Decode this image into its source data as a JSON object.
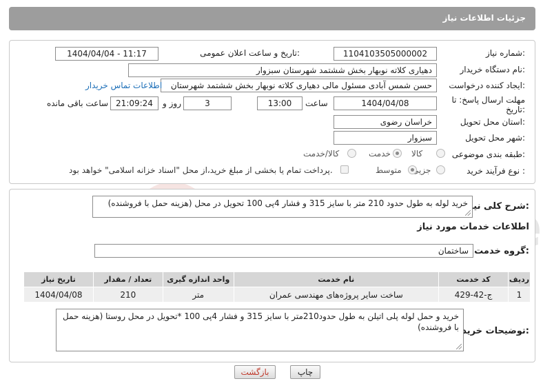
{
  "header": {
    "title": "جزئیات اطلاعات نیاز"
  },
  "form": {
    "need_number": {
      "label": "شماره نیاز:",
      "value": "1104103505000002"
    },
    "announce_datetime": {
      "label": "تاریخ و ساعت اعلان عمومی:",
      "value": "1404/04/04 - 11:17"
    },
    "buyer_org": {
      "label": "نام دستگاه خریدار:",
      "value": "دهیاری کلاته نوبهار بخش ششتمد شهرستان سبزوار"
    },
    "requester": {
      "label": "ایجاد کننده درخواست:",
      "value": "حسن شمس آبادی مسئول مالی دهیاری کلاته نوبهار بخش ششتمد شهرستان",
      "contact_link": "اطلاعات تماس خریدار"
    },
    "deadline": {
      "label_line1": "مهلت ارسال پاسخ: تا",
      "label_line2": "تاریخ:",
      "date": "1404/04/08",
      "time_label": "ساعت",
      "time": "13:00",
      "days": "3",
      "days_label": "روز و",
      "remaining": "21:09:24",
      "remaining_label": "ساعت باقی مانده"
    },
    "province": {
      "label": "استان محل تحویل:",
      "value": "خراسان رضوی"
    },
    "city": {
      "label": "شهر محل تحویل:",
      "value": "سبزوار"
    },
    "category": {
      "label": "طبقه بندی موضوعی:",
      "options": [
        "کالا",
        "خدمت",
        "کالا/خدمت"
      ],
      "selected": "خدمت"
    },
    "process": {
      "label": "نوع فرآیند خرید :",
      "options": [
        "جزیی",
        "متوسط"
      ],
      "selected": "متوسط",
      "payment_note": "پرداخت تمام یا بخشی از مبلغ خرید،از محل \"اسناد خزانه اسلامی\" خواهد بود."
    }
  },
  "summary": {
    "label": "شرح کلی نیاز:",
    "value": "خرید لوله به طول حدود 210 متر با سایز 315 و فشار 4پی 100 تحویل در محل (هزینه حمل با فروشنده)"
  },
  "services": {
    "section_title": "اطلاعات خدمات مورد نیاز",
    "group_label": "گروه خدمت:",
    "group_value": "ساختمان",
    "columns": [
      "ردیف",
      "کد خدمت",
      "نام خدمت",
      "واحد اندازه گیری",
      "تعداد / مقدار",
      "تاریخ نیاز"
    ],
    "rows": [
      {
        "row": "1",
        "code": "ج-42-429",
        "name": "ساخت سایر پروژه‌های مهندسی عمران",
        "unit": "متر",
        "qty": "210",
        "date": "1404/04/08"
      }
    ]
  },
  "buyer_notes": {
    "label": "توضیحات خریدار:",
    "value": "خرید و حمل لوله پلی اتیلن به طول حدود210متر با سایز 315 و فشار 4پی 100 *تحویل در محل روستا (هزینه حمل با فروشنده)"
  },
  "buttons": {
    "print": "چاپ",
    "back": "بازگشت"
  },
  "watermark_text": "AriaTender.neT",
  "colors": {
    "header_bg": "#9d9d9d",
    "link": "#1d6fb8",
    "back_button_text": "#c0392b"
  }
}
